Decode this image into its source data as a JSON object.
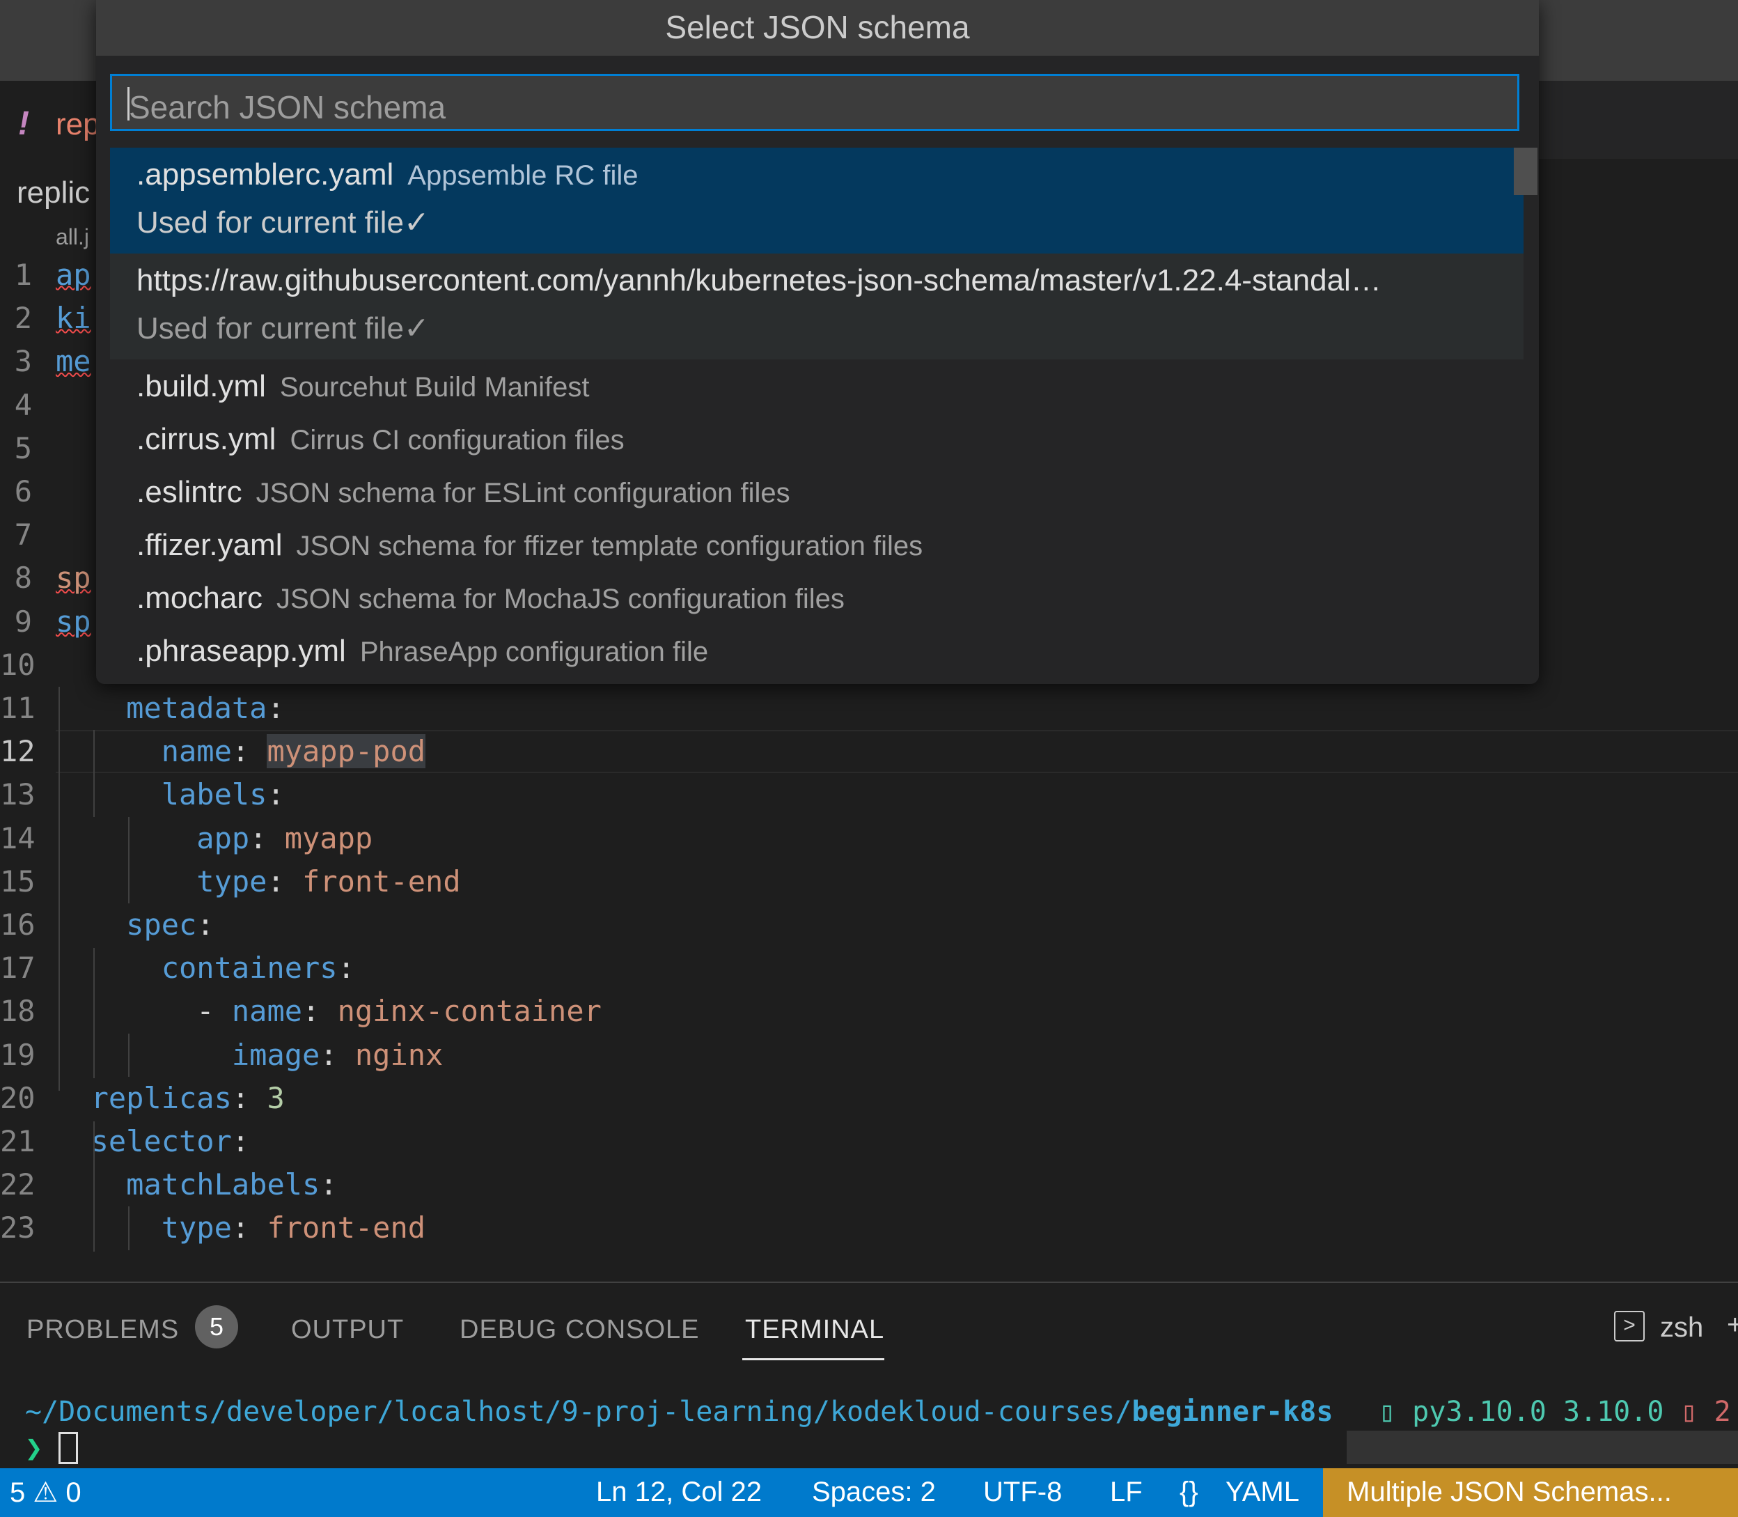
{
  "editor_tab": {
    "icon": "!",
    "label": "rep"
  },
  "breadcrumb": {
    "file": "replic",
    "sub": "all.j"
  },
  "quick_pick": {
    "title": "Select JSON schema",
    "search_placeholder": "Search JSON schema",
    "items": [
      {
        "label": ".appsemblerc.yaml",
        "description": "Appsemble RC file",
        "detail": "Used for current file✓",
        "state": "selected"
      },
      {
        "label": "https://raw.githubusercontent.com/yannh/kubernetes-json-schema/master/v1.22.4-standal…",
        "description": "",
        "detail": "Used for current file✓",
        "state": "hover"
      },
      {
        "label": ".build.yml",
        "description": "Sourcehut Build Manifest"
      },
      {
        "label": ".cirrus.yml",
        "description": "Cirrus CI configuration files"
      },
      {
        "label": ".eslintrc",
        "description": "JSON schema for ESLint configuration files"
      },
      {
        "label": ".ffizer.yaml",
        "description": "JSON schema for ffizer template configuration files"
      },
      {
        "label": ".mocharc",
        "description": "JSON schema for MochaJS configuration files"
      },
      {
        "label": ".phraseapp.yml",
        "description": "PhraseApp configuration file"
      }
    ]
  },
  "code": {
    "lines": [
      {
        "n": "1",
        "frag": [
          [
            "k err",
            "ap"
          ]
        ]
      },
      {
        "n": "2",
        "frag": [
          [
            "k err",
            "ki"
          ]
        ]
      },
      {
        "n": "3",
        "frag": [
          [
            "k err",
            "me"
          ]
        ]
      },
      {
        "n": "4",
        "frag": []
      },
      {
        "n": "5",
        "frag": []
      },
      {
        "n": "6",
        "frag": []
      },
      {
        "n": "7",
        "frag": []
      },
      {
        "n": "8",
        "frag": [
          [
            "s err",
            "sp"
          ]
        ]
      },
      {
        "n": "9",
        "frag": [
          [
            "k err",
            "sp"
          ]
        ]
      },
      {
        "n": "10",
        "frag": []
      },
      {
        "n": "11",
        "frag": [
          [
            "p",
            "    "
          ],
          [
            "k",
            "metadata"
          ],
          [
            "p",
            ":"
          ]
        ]
      },
      {
        "n": "12",
        "frag": [
          [
            "p",
            "      "
          ],
          [
            "k",
            "name"
          ],
          [
            "p",
            ": "
          ],
          [
            "s sel-word",
            "myapp-pod"
          ]
        ],
        "current": true
      },
      {
        "n": "13",
        "frag": [
          [
            "p",
            "      "
          ],
          [
            "k",
            "labels"
          ],
          [
            "p",
            ":"
          ]
        ]
      },
      {
        "n": "14",
        "frag": [
          [
            "p",
            "        "
          ],
          [
            "k",
            "app"
          ],
          [
            "p",
            ": "
          ],
          [
            "s",
            "myapp"
          ]
        ]
      },
      {
        "n": "15",
        "frag": [
          [
            "p",
            "        "
          ],
          [
            "k",
            "type"
          ],
          [
            "p",
            ": "
          ],
          [
            "s",
            "front-end"
          ]
        ]
      },
      {
        "n": "16",
        "frag": [
          [
            "p",
            "    "
          ],
          [
            "k",
            "spec"
          ],
          [
            "p",
            ":"
          ]
        ]
      },
      {
        "n": "17",
        "frag": [
          [
            "p",
            "      "
          ],
          [
            "k",
            "containers"
          ],
          [
            "p",
            ":"
          ]
        ]
      },
      {
        "n": "18",
        "frag": [
          [
            "p",
            "        - "
          ],
          [
            "k",
            "name"
          ],
          [
            "p",
            ": "
          ],
          [
            "s",
            "nginx-container"
          ]
        ]
      },
      {
        "n": "19",
        "frag": [
          [
            "p",
            "          "
          ],
          [
            "k",
            "image"
          ],
          [
            "p",
            ": "
          ],
          [
            "s",
            "nginx"
          ]
        ]
      },
      {
        "n": "20",
        "frag": [
          [
            "p",
            "  "
          ],
          [
            "k",
            "replicas"
          ],
          [
            "p",
            ": "
          ],
          [
            "n",
            "3"
          ]
        ]
      },
      {
        "n": "21",
        "frag": [
          [
            "p",
            "  "
          ],
          [
            "k",
            "selector"
          ],
          [
            "p",
            ":"
          ]
        ]
      },
      {
        "n": "22",
        "frag": [
          [
            "p",
            "    "
          ],
          [
            "k",
            "matchLabels"
          ],
          [
            "p",
            ":"
          ]
        ]
      },
      {
        "n": "23",
        "frag": [
          [
            "p",
            "      "
          ],
          [
            "k",
            "type"
          ],
          [
            "p",
            ": "
          ],
          [
            "s",
            "front-end"
          ]
        ]
      }
    ]
  },
  "panel": {
    "tabs": [
      "PROBLEMS",
      "OUTPUT",
      "DEBUG CONSOLE",
      "TERMINAL"
    ],
    "problems_count": "5",
    "active_tab": "TERMINAL",
    "shell": "zsh",
    "plus": "+",
    "terminal": {
      "path": "~/Documents/developer/localhost/9-proj-learning/kodekloud-courses/",
      "path_bold": "beginner-k8s",
      "right_box": "▯",
      "right_text": " py3.10.0 3.10.0 ",
      "right_end": "▯ 2",
      "prompt": "❯"
    }
  },
  "statusbar": {
    "errors": "5",
    "warnings": "0",
    "position": "Ln 12, Col 22",
    "spaces": "Spaces: 2",
    "encoding": "UTF-8",
    "eol": "LF",
    "language_icon": "{}",
    "language": "YAML",
    "schemas": "Multiple JSON Schemas..."
  },
  "colors": {
    "accent": "#007acc",
    "selection": "#04395e",
    "warning_zone": "#c69026"
  }
}
